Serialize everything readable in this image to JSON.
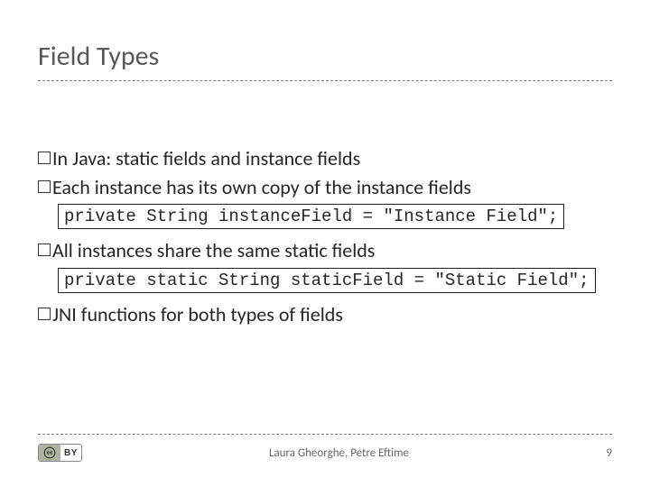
{
  "title": "Field Types",
  "bullets": {
    "b0": "In Java: static fields and instance fields",
    "b1": "Each instance has its own copy of the instance fields",
    "b2": "All instances share the same static fields",
    "b3": "JNI functions for both types of fields"
  },
  "code": {
    "c0": "private String instanceField = \"Instance Field\";",
    "c1": "private static String staticField = \"Static Field\";"
  },
  "footer": {
    "credits": "Laura Gheorghe, Petre Eftime",
    "page": "9",
    "cc_label": "BY"
  }
}
